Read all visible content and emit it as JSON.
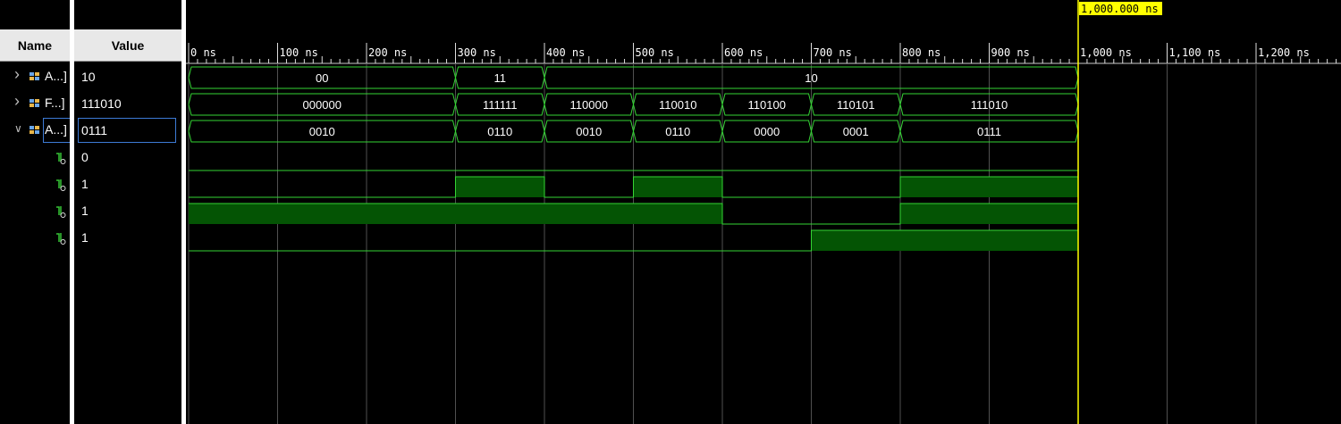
{
  "header": {
    "name_label": "Name",
    "value_label": "Value"
  },
  "signals": [
    {
      "name": "A...]",
      "value": "10",
      "kind": "bus",
      "expanded": false,
      "icon": "bus-icon"
    },
    {
      "name": "F...]",
      "value": "111010",
      "kind": "bus",
      "expanded": false,
      "icon": "bus-icon"
    },
    {
      "name": "A...]",
      "value": "0111",
      "kind": "bus",
      "expanded": true,
      "icon": "bus-icon",
      "selected": true
    },
    {
      "name": "",
      "value": "0",
      "kind": "bit",
      "icon": "bit-icon"
    },
    {
      "name": "",
      "value": "1",
      "kind": "bit",
      "icon": "bit-icon"
    },
    {
      "name": "",
      "value": "1",
      "kind": "bit",
      "icon": "bit-icon"
    },
    {
      "name": "",
      "value": "1",
      "kind": "bit",
      "icon": "bit-icon"
    }
  ],
  "timeline": {
    "tick_labels": [
      "0 ns",
      "100 ns",
      "200 ns",
      "300 ns",
      "400 ns",
      "500 ns",
      "600 ns",
      "700 ns",
      "800 ns",
      "900 ns",
      "1,000 ns",
      "1,100 ns",
      "1,200 ns"
    ],
    "tick_times": [
      0,
      100,
      200,
      300,
      400,
      500,
      600,
      700,
      800,
      900,
      1000,
      1100,
      1200
    ],
    "cursor_label": "1,000.000 ns",
    "cursor_time": 1000,
    "sim_end": 1000
  },
  "waves": {
    "bus": [
      {
        "segments": [
          {
            "start": 0,
            "end": 300,
            "value": "00"
          },
          {
            "start": 300,
            "end": 400,
            "value": "11"
          },
          {
            "start": 400,
            "end": 1000,
            "value": "10"
          }
        ]
      },
      {
        "segments": [
          {
            "start": 0,
            "end": 300,
            "value": "000000"
          },
          {
            "start": 300,
            "end": 400,
            "value": "111111"
          },
          {
            "start": 400,
            "end": 500,
            "value": "110000"
          },
          {
            "start": 500,
            "end": 600,
            "value": "110010"
          },
          {
            "start": 600,
            "end": 700,
            "value": "110100"
          },
          {
            "start": 700,
            "end": 800,
            "value": "110101"
          },
          {
            "start": 800,
            "end": 1000,
            "value": "111010"
          }
        ]
      },
      {
        "segments": [
          {
            "start": 0,
            "end": 300,
            "value": "0010"
          },
          {
            "start": 300,
            "end": 400,
            "value": "0110"
          },
          {
            "start": 400,
            "end": 500,
            "value": "0010"
          },
          {
            "start": 500,
            "end": 600,
            "value": "0110"
          },
          {
            "start": 600,
            "end": 700,
            "value": "0000"
          },
          {
            "start": 700,
            "end": 800,
            "value": "0001"
          },
          {
            "start": 800,
            "end": 1000,
            "value": "0111"
          }
        ]
      }
    ],
    "bits": [
      {
        "segments": [
          {
            "start": 0,
            "end": 1000,
            "level": 0
          }
        ]
      },
      {
        "segments": [
          {
            "start": 0,
            "end": 300,
            "level": 0
          },
          {
            "start": 300,
            "end": 400,
            "level": 1
          },
          {
            "start": 400,
            "end": 500,
            "level": 0
          },
          {
            "start": 500,
            "end": 600,
            "level": 1
          },
          {
            "start": 600,
            "end": 800,
            "level": 0
          },
          {
            "start": 800,
            "end": 1000,
            "level": 1
          }
        ]
      },
      {
        "segments": [
          {
            "start": 0,
            "end": 600,
            "level": 1
          },
          {
            "start": 600,
            "end": 800,
            "level": 0
          },
          {
            "start": 800,
            "end": 1000,
            "level": 1
          }
        ]
      },
      {
        "segments": [
          {
            "start": 0,
            "end": 700,
            "level": 0
          },
          {
            "start": 700,
            "end": 1000,
            "level": 1
          }
        ]
      }
    ]
  },
  "colors": {
    "wave": "#35d435",
    "fill": "#045404",
    "cursor": "#ffff00",
    "grid": "#505050",
    "selection": "#3d7bd6"
  }
}
